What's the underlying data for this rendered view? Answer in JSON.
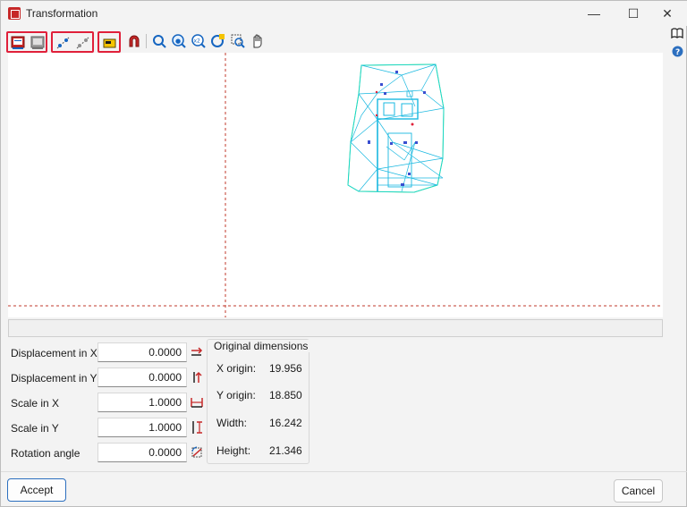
{
  "window": {
    "title": "Transformation"
  },
  "titlebar": {
    "minimize": "—",
    "maximize": "☐",
    "close": "✕"
  },
  "form": {
    "fields": [
      {
        "label": "Displacement in X",
        "value": "0.0000"
      },
      {
        "label": "Displacement in Y",
        "value": "0.0000"
      },
      {
        "label": "Scale in X",
        "value": "1.0000"
      },
      {
        "label": "Scale in Y",
        "value": "1.0000"
      },
      {
        "label": "Rotation angle",
        "value": "0.0000"
      }
    ]
  },
  "original_dimensions": {
    "title": "Original dimensions",
    "rows": [
      {
        "label": "X origin:",
        "value": "19.956"
      },
      {
        "label": "Y origin:",
        "value": "18.850"
      },
      {
        "label": "Width:",
        "value": "16.242"
      },
      {
        "label": "Height:",
        "value": "21.346"
      }
    ]
  },
  "buttons": {
    "accept": "Accept",
    "cancel": "Cancel"
  },
  "colors": {
    "accent": "#2c6fbf",
    "highlight": "#e0203a",
    "guide": "#c0392b",
    "plan": "#19d8d8"
  }
}
